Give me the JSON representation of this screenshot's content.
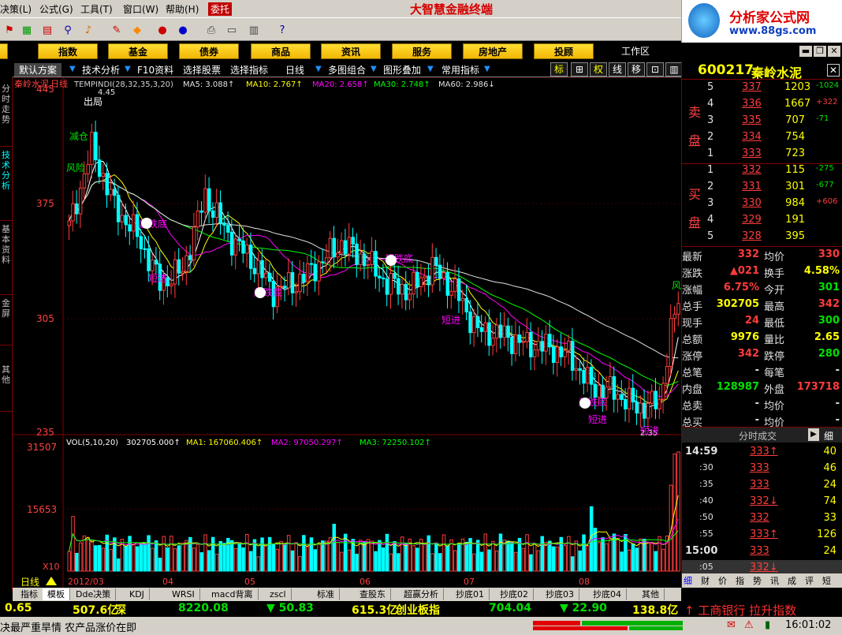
{
  "menu": {
    "items": [
      "决策(L)",
      "公式(G)",
      "工具(T)",
      "窗口(W)",
      "帮助(H)"
    ],
    "weituo": "委托",
    "brand": "大智慧金融终端"
  },
  "logo": {
    "text1": "分析家公式网",
    "text2": "www.88gs.com"
  },
  "categories": [
    "股",
    "指数",
    "基金",
    "债券",
    "商品",
    "资讯",
    "服务",
    "房地产",
    "投顾"
  ],
  "workarea": "工作区",
  "tabs": {
    "scheme": "默认方案",
    "items": [
      "技术分析",
      "F10资料",
      "选择股票",
      "选择指标",
      "日线",
      "多图组合",
      "图形叠加",
      "常用指标"
    ],
    "tools": [
      "标",
      "⊞",
      "权",
      "线",
      "移",
      "⊡",
      "▥"
    ]
  },
  "leftbar": [
    "分时走势",
    "技术分析",
    "基本资料",
    "金屏",
    "其他"
  ],
  "chart": {
    "stock_name": "秦岭水泥",
    "period": "日线",
    "indicator_line": "TEMPINDI(28,32,35,3,20)",
    "ma_labels": [
      "MA5: 3.088↑",
      "MA10: 2.767↑",
      "MA20: 2.658↑",
      "MA30: 2.748↑",
      "MA60: 2.986↓"
    ],
    "y_labels": [
      "445",
      "375",
      "305",
      "235"
    ],
    "price_annotations": [
      "4.45",
      "2.35"
    ],
    "text_annotations": [
      "出局",
      "减仓",
      "风险",
      "超跌底",
      "短进",
      "超跌底",
      "超跌底",
      "短进",
      "超跌底",
      "短进",
      "短进",
      "风"
    ],
    "vol_header": "VOL(5,10,20)",
    "vol_values": [
      "302705.000↑",
      "MA1: 167060.406↑",
      "MA2: 97050.297↑",
      "MA3: 72250.102↑"
    ],
    "vol_y_labels": [
      "31507",
      "15653",
      "X10"
    ],
    "date_labels": [
      "2012/03",
      "04",
      "05",
      "06",
      "07",
      "08"
    ],
    "period_footer": "日线"
  },
  "chart_data": {
    "type": "candlestick",
    "title": "秦岭水泥 日线",
    "y_unit": "price (x100 as printed on axis)",
    "ylim": [
      235,
      445
    ],
    "high_label": 4.45,
    "low_label": 2.35,
    "ma": {
      "MA5": 3.088,
      "MA10": 2.767,
      "MA20": 2.658,
      "MA30": 2.748,
      "MA60": 2.986
    },
    "volume_ma": {
      "VOL": 302705.0,
      "MA1": 167060.406,
      "MA2": 97050.297,
      "MA3": 72250.102
    },
    "vol_ylim": [
      0,
      31507
    ],
    "months": [
      "2012/03",
      "04",
      "05",
      "06",
      "07",
      "08"
    ]
  },
  "quote": {
    "code": "600217",
    "name": "秦岭水泥",
    "sell_label": [
      "卖",
      "盘"
    ],
    "buy_label": [
      "买",
      "盘"
    ],
    "sell": [
      {
        "lvl": "5",
        "price": "337",
        "vol": "1203",
        "chg": "-1024"
      },
      {
        "lvl": "4",
        "price": "336",
        "vol": "1667",
        "chg": "+322"
      },
      {
        "lvl": "3",
        "price": "335",
        "vol": "707",
        "chg": "-71"
      },
      {
        "lvl": "2",
        "price": "334",
        "vol": "754",
        "chg": ""
      },
      {
        "lvl": "1",
        "price": "333",
        "vol": "723",
        "chg": ""
      }
    ],
    "buy": [
      {
        "lvl": "1",
        "price": "332",
        "vol": "115",
        "chg": "-275"
      },
      {
        "lvl": "2",
        "price": "331",
        "vol": "301",
        "chg": "-677"
      },
      {
        "lvl": "3",
        "price": "330",
        "vol": "984",
        "chg": "+606"
      },
      {
        "lvl": "4",
        "price": "329",
        "vol": "191",
        "chg": ""
      },
      {
        "lvl": "5",
        "price": "328",
        "vol": "395",
        "chg": ""
      }
    ],
    "stats": [
      {
        "l1": "最新",
        "v1": "332",
        "l2": "均价",
        "v2": "330"
      },
      {
        "l1": "涨跌",
        "v1": "▲021",
        "l2": "换手",
        "v2": "4.58%"
      },
      {
        "l1": "涨幅",
        "v1": "6.75%",
        "l2": "今开",
        "v2": "301"
      },
      {
        "l1": "总手",
        "v1": "302705",
        "l2": "最高",
        "v2": "342"
      },
      {
        "l1": "现手",
        "v1": "24",
        "l2": "最低",
        "v2": "300"
      },
      {
        "l1": "总额",
        "v1": "9976",
        "l2": "量比",
        "v2": "2.65"
      },
      {
        "l1": "涨停",
        "v1": "342",
        "l2": "跌停",
        "v2": "280"
      },
      {
        "l1": "总笔",
        "v1": "-",
        "l2": "每笔",
        "v2": "-"
      },
      {
        "l1": "内盘",
        "v1": "128987",
        "l2": "外盘",
        "v2": "173718"
      },
      {
        "l1": "总卖",
        "v1": "-",
        "l2": "均价",
        "v2": "-"
      },
      {
        "l1": "总买",
        "v1": "-",
        "l2": "均价",
        "v2": "-"
      }
    ],
    "ticks_title": "分时成交",
    "ticks_btn": "细",
    "ticks": [
      {
        "t": "14:59",
        "p": "333↑",
        "v": "40",
        "c": "red"
      },
      {
        "t": ":30",
        "p": "333",
        "v": "46",
        "c": "red"
      },
      {
        "t": ":35",
        "p": "333",
        "v": "24",
        "c": "red"
      },
      {
        "t": ":40",
        "p": "332↓",
        "v": "74",
        "c": "red"
      },
      {
        "t": ":50",
        "p": "332",
        "v": "33",
        "c": "red"
      },
      {
        "t": ":55",
        "p": "333↑",
        "v": "126",
        "c": "red"
      },
      {
        "t": "15:00",
        "p": "333",
        "v": "24",
        "c": "red"
      },
      {
        "t": ":05",
        "p": "332↓",
        "v": "",
        "c": "red"
      }
    ],
    "bottom_tabs": [
      "细",
      "财",
      "价",
      "指",
      "势",
      "讯",
      "成",
      "评",
      "短"
    ]
  },
  "bottom_tabs": [
    "指标",
    "模板",
    "Dde决策",
    "KDJ",
    "WRSI",
    "macd背离",
    "zscl",
    "标准",
    "查股东",
    "超赢分析",
    "抄底01",
    "抄底02",
    "抄底03",
    "抄底04",
    "其他"
  ],
  "ticker": {
    "a": "0.65",
    "b": "507.6亿",
    "c": "深",
    "d": "8220.08",
    "e": "▼ 50.83",
    "f": "615.3亿",
    "g": "创业板指",
    "h": "704.04",
    "i": "▼ 22.90",
    "j": "138.8亿",
    "k": "↑ 工商银行 拉升指数"
  },
  "status": {
    "news": "决最严重旱情 农产品涨价在即",
    "time": "16:01:02"
  }
}
